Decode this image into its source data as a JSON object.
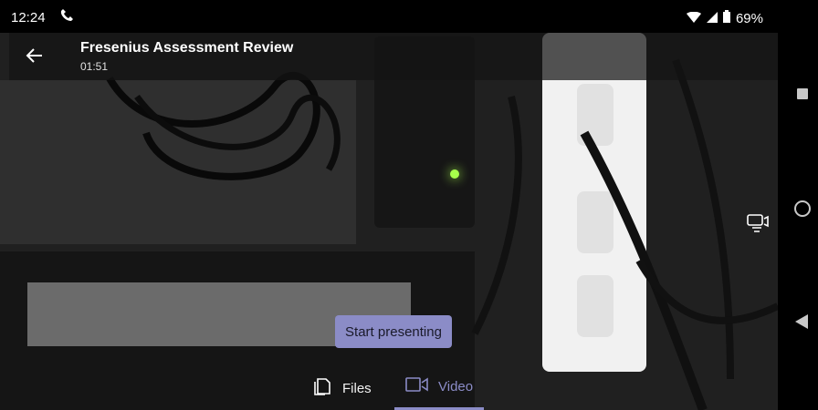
{
  "status_bar": {
    "time": "12:24",
    "battery": "69%",
    "icons": [
      "phone-icon",
      "wifi-icon",
      "signal-icon",
      "battery-icon"
    ]
  },
  "meeting": {
    "title": "Fresenius Assessment Review",
    "duration": "01:51"
  },
  "actions": {
    "start_presenting": "Start presenting"
  },
  "tabs": [
    {
      "label": "Files",
      "icon": "files-icon",
      "selected": false
    },
    {
      "label": "Video",
      "icon": "video-icon",
      "selected": true
    }
  ],
  "colors": {
    "accent": "#8b8cc7",
    "overlay": "#141414",
    "background": "#000000"
  }
}
